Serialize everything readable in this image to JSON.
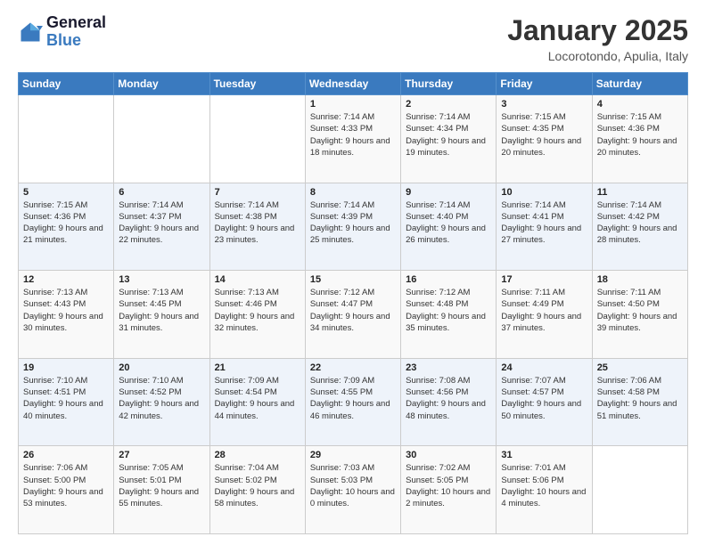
{
  "logo": {
    "line1": "General",
    "line2": "Blue"
  },
  "header": {
    "month_title": "January 2025",
    "location": "Locorotondo, Apulia, Italy"
  },
  "weekdays": [
    "Sunday",
    "Monday",
    "Tuesday",
    "Wednesday",
    "Thursday",
    "Friday",
    "Saturday"
  ],
  "weeks": [
    [
      {
        "day": "",
        "sunrise": "",
        "sunset": "",
        "daylight": ""
      },
      {
        "day": "",
        "sunrise": "",
        "sunset": "",
        "daylight": ""
      },
      {
        "day": "",
        "sunrise": "",
        "sunset": "",
        "daylight": ""
      },
      {
        "day": "1",
        "sunrise": "Sunrise: 7:14 AM",
        "sunset": "Sunset: 4:33 PM",
        "daylight": "Daylight: 9 hours and 18 minutes."
      },
      {
        "day": "2",
        "sunrise": "Sunrise: 7:14 AM",
        "sunset": "Sunset: 4:34 PM",
        "daylight": "Daylight: 9 hours and 19 minutes."
      },
      {
        "day": "3",
        "sunrise": "Sunrise: 7:15 AM",
        "sunset": "Sunset: 4:35 PM",
        "daylight": "Daylight: 9 hours and 20 minutes."
      },
      {
        "day": "4",
        "sunrise": "Sunrise: 7:15 AM",
        "sunset": "Sunset: 4:36 PM",
        "daylight": "Daylight: 9 hours and 20 minutes."
      }
    ],
    [
      {
        "day": "5",
        "sunrise": "Sunrise: 7:15 AM",
        "sunset": "Sunset: 4:36 PM",
        "daylight": "Daylight: 9 hours and 21 minutes."
      },
      {
        "day": "6",
        "sunrise": "Sunrise: 7:14 AM",
        "sunset": "Sunset: 4:37 PM",
        "daylight": "Daylight: 9 hours and 22 minutes."
      },
      {
        "day": "7",
        "sunrise": "Sunrise: 7:14 AM",
        "sunset": "Sunset: 4:38 PM",
        "daylight": "Daylight: 9 hours and 23 minutes."
      },
      {
        "day": "8",
        "sunrise": "Sunrise: 7:14 AM",
        "sunset": "Sunset: 4:39 PM",
        "daylight": "Daylight: 9 hours and 25 minutes."
      },
      {
        "day": "9",
        "sunrise": "Sunrise: 7:14 AM",
        "sunset": "Sunset: 4:40 PM",
        "daylight": "Daylight: 9 hours and 26 minutes."
      },
      {
        "day": "10",
        "sunrise": "Sunrise: 7:14 AM",
        "sunset": "Sunset: 4:41 PM",
        "daylight": "Daylight: 9 hours and 27 minutes."
      },
      {
        "day": "11",
        "sunrise": "Sunrise: 7:14 AM",
        "sunset": "Sunset: 4:42 PM",
        "daylight": "Daylight: 9 hours and 28 minutes."
      }
    ],
    [
      {
        "day": "12",
        "sunrise": "Sunrise: 7:13 AM",
        "sunset": "Sunset: 4:43 PM",
        "daylight": "Daylight: 9 hours and 30 minutes."
      },
      {
        "day": "13",
        "sunrise": "Sunrise: 7:13 AM",
        "sunset": "Sunset: 4:45 PM",
        "daylight": "Daylight: 9 hours and 31 minutes."
      },
      {
        "day": "14",
        "sunrise": "Sunrise: 7:13 AM",
        "sunset": "Sunset: 4:46 PM",
        "daylight": "Daylight: 9 hours and 32 minutes."
      },
      {
        "day": "15",
        "sunrise": "Sunrise: 7:12 AM",
        "sunset": "Sunset: 4:47 PM",
        "daylight": "Daylight: 9 hours and 34 minutes."
      },
      {
        "day": "16",
        "sunrise": "Sunrise: 7:12 AM",
        "sunset": "Sunset: 4:48 PM",
        "daylight": "Daylight: 9 hours and 35 minutes."
      },
      {
        "day": "17",
        "sunrise": "Sunrise: 7:11 AM",
        "sunset": "Sunset: 4:49 PM",
        "daylight": "Daylight: 9 hours and 37 minutes."
      },
      {
        "day": "18",
        "sunrise": "Sunrise: 7:11 AM",
        "sunset": "Sunset: 4:50 PM",
        "daylight": "Daylight: 9 hours and 39 minutes."
      }
    ],
    [
      {
        "day": "19",
        "sunrise": "Sunrise: 7:10 AM",
        "sunset": "Sunset: 4:51 PM",
        "daylight": "Daylight: 9 hours and 40 minutes."
      },
      {
        "day": "20",
        "sunrise": "Sunrise: 7:10 AM",
        "sunset": "Sunset: 4:52 PM",
        "daylight": "Daylight: 9 hours and 42 minutes."
      },
      {
        "day": "21",
        "sunrise": "Sunrise: 7:09 AM",
        "sunset": "Sunset: 4:54 PM",
        "daylight": "Daylight: 9 hours and 44 minutes."
      },
      {
        "day": "22",
        "sunrise": "Sunrise: 7:09 AM",
        "sunset": "Sunset: 4:55 PM",
        "daylight": "Daylight: 9 hours and 46 minutes."
      },
      {
        "day": "23",
        "sunrise": "Sunrise: 7:08 AM",
        "sunset": "Sunset: 4:56 PM",
        "daylight": "Daylight: 9 hours and 48 minutes."
      },
      {
        "day": "24",
        "sunrise": "Sunrise: 7:07 AM",
        "sunset": "Sunset: 4:57 PM",
        "daylight": "Daylight: 9 hours and 50 minutes."
      },
      {
        "day": "25",
        "sunrise": "Sunrise: 7:06 AM",
        "sunset": "Sunset: 4:58 PM",
        "daylight": "Daylight: 9 hours and 51 minutes."
      }
    ],
    [
      {
        "day": "26",
        "sunrise": "Sunrise: 7:06 AM",
        "sunset": "Sunset: 5:00 PM",
        "daylight": "Daylight: 9 hours and 53 minutes."
      },
      {
        "day": "27",
        "sunrise": "Sunrise: 7:05 AM",
        "sunset": "Sunset: 5:01 PM",
        "daylight": "Daylight: 9 hours and 55 minutes."
      },
      {
        "day": "28",
        "sunrise": "Sunrise: 7:04 AM",
        "sunset": "Sunset: 5:02 PM",
        "daylight": "Daylight: 9 hours and 58 minutes."
      },
      {
        "day": "29",
        "sunrise": "Sunrise: 7:03 AM",
        "sunset": "Sunset: 5:03 PM",
        "daylight": "Daylight: 10 hours and 0 minutes."
      },
      {
        "day": "30",
        "sunrise": "Sunrise: 7:02 AM",
        "sunset": "Sunset: 5:05 PM",
        "daylight": "Daylight: 10 hours and 2 minutes."
      },
      {
        "day": "31",
        "sunrise": "Sunrise: 7:01 AM",
        "sunset": "Sunset: 5:06 PM",
        "daylight": "Daylight: 10 hours and 4 minutes."
      },
      {
        "day": "",
        "sunrise": "",
        "sunset": "",
        "daylight": ""
      }
    ]
  ]
}
